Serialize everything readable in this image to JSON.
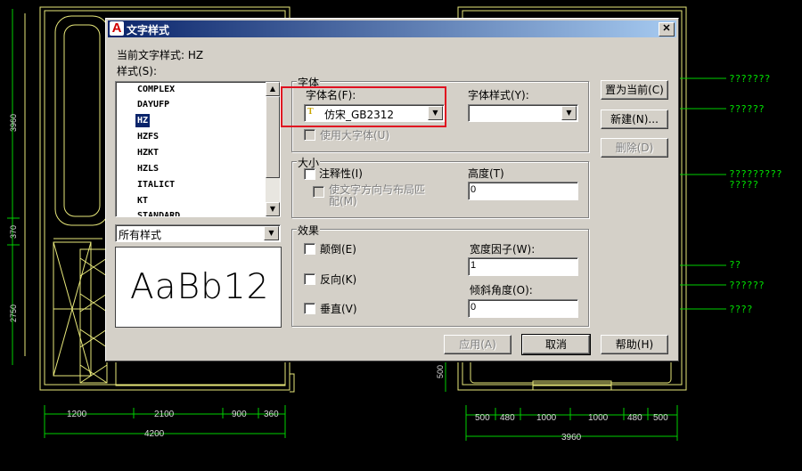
{
  "dialog": {
    "title": "文字样式",
    "app_icon_letter": "A",
    "close_glyph": "✕",
    "current_style_label": "当前文字样式:  HZ",
    "styles_label": "样式(S):",
    "style_list": [
      "COMPLEX",
      "DAYUFP",
      "HZ",
      "HZFS",
      "HZKT",
      "HZLS",
      "ITALICT",
      "KT",
      "STANDARD"
    ],
    "selected_style": "HZ",
    "filter": {
      "value": "所有样式"
    },
    "preview_text": "AaBb12",
    "font_group": {
      "legend": "字体",
      "font_name_label": "字体名(F):",
      "font_name_value": "仿宋_GB2312",
      "font_type_icon": "truetype-icon",
      "font_style_label": "字体样式(Y):",
      "font_style_value": "",
      "use_big_font_label": "使用大字体(U)"
    },
    "size_group": {
      "legend": "大小",
      "annotative_label": "注释性(I)",
      "match_orientation_label": "使文字方向与布局匹配(M)",
      "height_label": "高度(T)",
      "height_value": "0"
    },
    "effects_group": {
      "legend": "效果",
      "upside_down_label": "颠倒(E)",
      "backwards_label": "反向(K)",
      "vertical_label": "垂直(V)",
      "width_factor_label": "宽度因子(W):",
      "width_factor_value": "1",
      "oblique_label": "倾斜角度(O):",
      "oblique_value": "0"
    },
    "buttons": {
      "set_current": "置为当前(C)",
      "new": "新建(N)...",
      "delete": "删除(D)",
      "apply": "应用(A)",
      "cancel": "取消",
      "help": "帮助(H)"
    }
  },
  "cad_drawing": {
    "layer_color_lines": "#e8e87a",
    "dim_color": "#00d000",
    "left_dims_bottom": [
      "1200",
      "2100",
      "900",
      "360"
    ],
    "left_dims_total": "4200",
    "left_dims_vertical": [
      "3960",
      "370",
      "2750"
    ],
    "right_dims_bottom": [
      "500",
      "480",
      "1000",
      "1000",
      "480",
      "500"
    ],
    "right_dims_total": "3960",
    "right_dim_vertical": "500",
    "annotations": [
      "???????",
      "??????",
      "?????????\n?????",
      "??",
      "??????",
      "????"
    ]
  }
}
